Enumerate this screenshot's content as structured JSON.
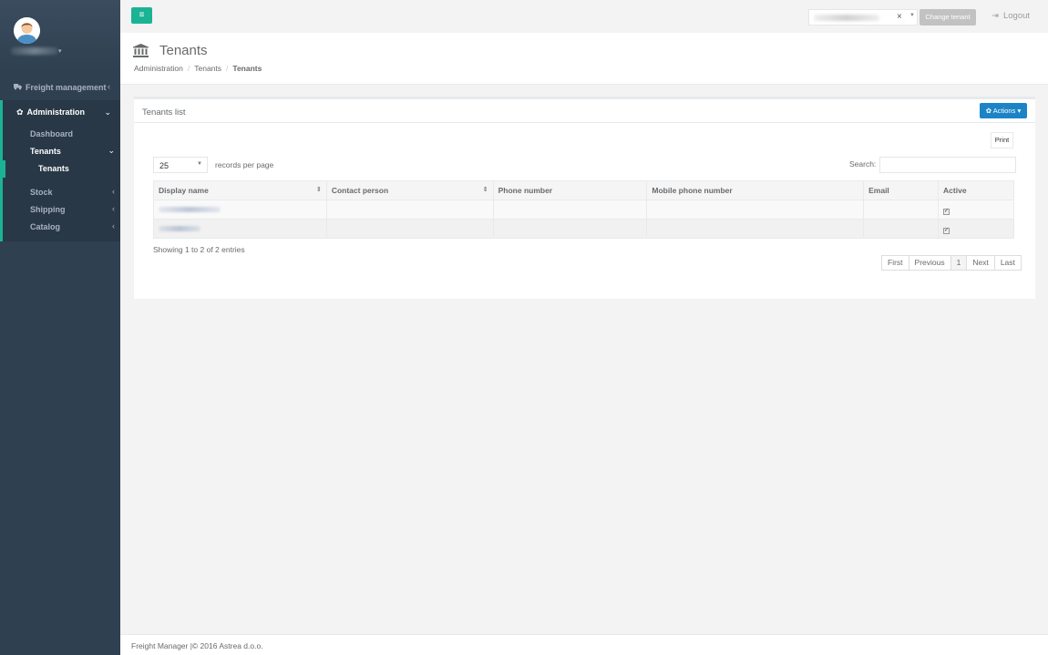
{
  "sidebar": {
    "user": {
      "name": "",
      "avatar_icon": "user-avatar"
    },
    "items": [
      {
        "label": "Freight management",
        "icon": "truck-icon"
      },
      {
        "label": "Administration",
        "icon": "gear-icon",
        "children": [
          {
            "label": "Dashboard"
          },
          {
            "label": "Tenants",
            "children": [
              {
                "label": "Tenants"
              }
            ]
          }
        ]
      },
      {
        "label": "Stock"
      },
      {
        "label": "Shipping"
      },
      {
        "label": "Catalog"
      }
    ]
  },
  "topbar": {
    "menu_icon": "hamburger-icon",
    "tenant_select": {
      "value": "",
      "clear": "×"
    },
    "change_tenant_label": "Change tenant",
    "logout_label": "Logout"
  },
  "heading": {
    "icon": "bank-icon",
    "title": "Tenants",
    "breadcrumb": [
      "Administration",
      "Tenants",
      "Tenants"
    ]
  },
  "panel": {
    "title": "Tenants list",
    "actions_label": "Actions",
    "print_label": "Print",
    "page_length": "25",
    "page_length_label": "records per page",
    "search_label": "Search:",
    "search_value": "",
    "columns": [
      "Display name",
      "Contact person",
      "Phone number",
      "Mobile phone number",
      "Email",
      "Active"
    ],
    "rows": [
      {
        "display_name": "",
        "contact_person": "",
        "phone": "",
        "mobile": "",
        "email": "",
        "active": true
      },
      {
        "display_name": "",
        "contact_person": "",
        "phone": "",
        "mobile": "",
        "email": "",
        "active": true
      }
    ],
    "info": "Showing 1 to 2 of 2 entries",
    "pagination": [
      "First",
      "Previous",
      "1",
      "Next",
      "Last"
    ]
  },
  "footer": {
    "text": "Freight Manager |© 2016 Astrea d.o.o."
  },
  "colors": {
    "sidebar_bg": "#2f4050",
    "accent": "#1ab394",
    "primary_btn": "#1c84c6"
  }
}
